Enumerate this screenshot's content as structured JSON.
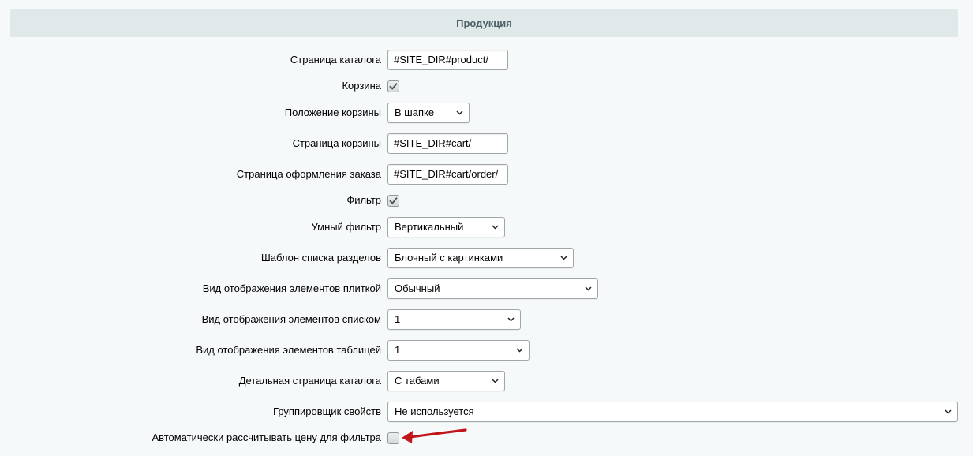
{
  "section": {
    "title": "Продукция"
  },
  "fields": {
    "catalog_page": {
      "label": "Страница каталога",
      "value": "#SITE_DIR#product/"
    },
    "basket": {
      "label": "Корзина",
      "checked": true
    },
    "basket_position": {
      "label": "Положение корзины",
      "value": "В шапке"
    },
    "basket_page": {
      "label": "Страница корзины",
      "value": "#SITE_DIR#cart/"
    },
    "order_page": {
      "label": "Страница оформления заказа",
      "value": "#SITE_DIR#cart/order/"
    },
    "filter": {
      "label": "Фильтр",
      "checked": true
    },
    "smart_filter": {
      "label": "Умный фильтр",
      "value": "Вертикальный"
    },
    "sections_template": {
      "label": "Шаблон списка разделов",
      "value": "Блочный с картинками"
    },
    "tile_view": {
      "label": "Вид отображения элементов плиткой",
      "value": "Обычный"
    },
    "list_view": {
      "label": "Вид отображения элементов списком",
      "value": "1"
    },
    "table_view": {
      "label": "Вид отображения элементов таблицей",
      "value": "1"
    },
    "detail_page": {
      "label": "Детальная страница каталога",
      "value": "С табами"
    },
    "props_grouper": {
      "label": "Группировщик свойств",
      "value": "Не используется"
    },
    "auto_price_filter": {
      "label": "Автоматически рассчитывать цену для фильтра",
      "checked": false
    }
  },
  "colors": {
    "background": "#f5f9f9",
    "header_bg": "#e0e8ea",
    "header_text": "#4b6267",
    "annotation_arrow": "#c0151b"
  },
  "icons": {
    "select_arrow": "chevron-down-icon",
    "check_mark": "check-icon",
    "annotation": "red-arrow-icon"
  }
}
